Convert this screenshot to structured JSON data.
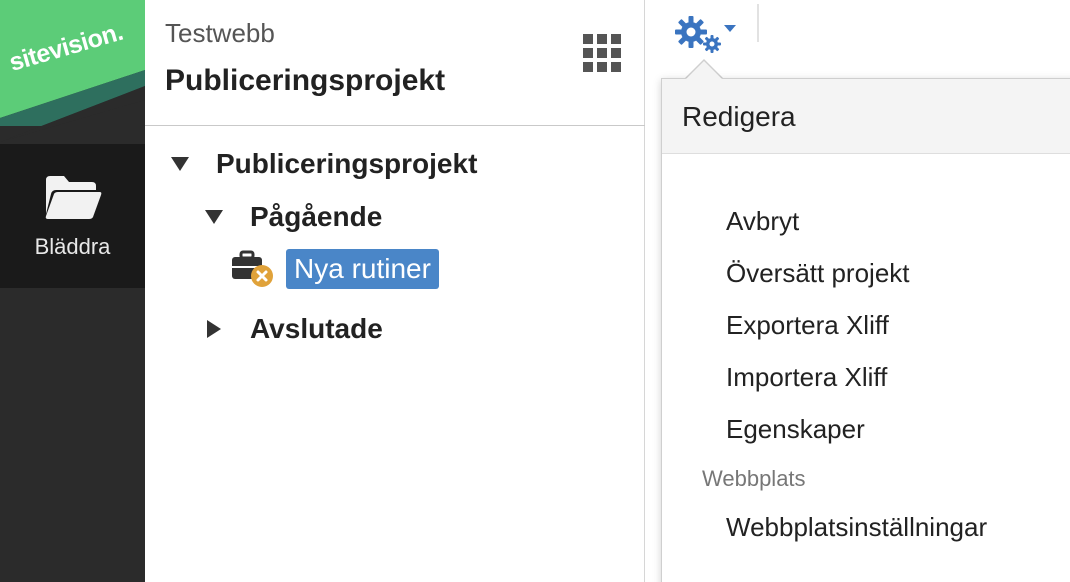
{
  "app": {
    "logo_text": "sitevision.",
    "brand_green": "#5ccc78",
    "brand_dark_green": "#2e6f5e"
  },
  "rail": {
    "browse_label": "Bläddra",
    "browse_icon": "folder-open-icon"
  },
  "panel": {
    "site_name": "Testwebb",
    "title": "Publiceringsprojekt",
    "apps_icon": "grid-icon"
  },
  "tree": {
    "root_label": "Publiceringsprojekt",
    "ongoing_label": "Pågående",
    "selected_item_label": "Nya rutiner",
    "finished_label": "Avslutade",
    "selected_item_icon": "briefcase-cancel-icon",
    "selection_color": "#4a86c8"
  },
  "toolbar": {
    "settings_icon": "gears-icon",
    "accent": "#3a74c0"
  },
  "menu": {
    "header": "Redigera",
    "items": [
      "Avbryt",
      "Översätt projekt",
      "Exportera Xliff",
      "Importera Xliff",
      "Egenskaper"
    ],
    "group_label": "Webbplats",
    "group_items": [
      "Webbplatsinställningar"
    ]
  }
}
